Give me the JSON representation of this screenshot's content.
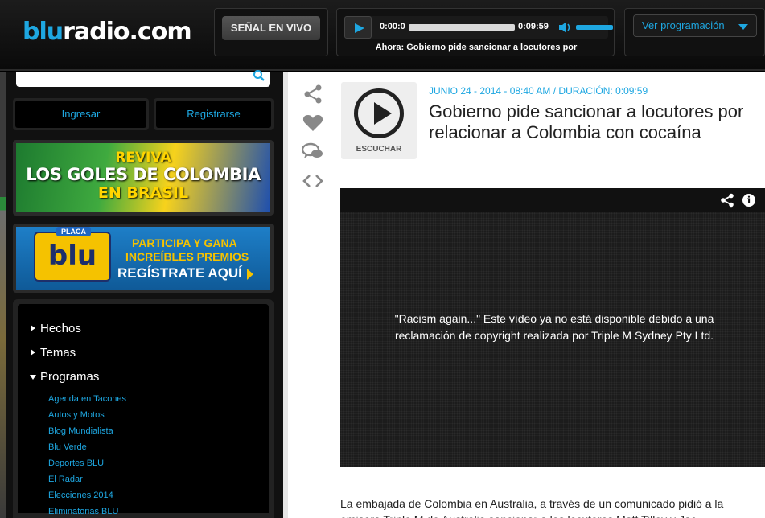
{
  "header": {
    "logo_prefix": "blu",
    "logo_suffix": "radio.com",
    "live_label": "SEÑAL EN VIVO",
    "player": {
      "current_time": "0:00:0",
      "duration": "0:09:59",
      "now_playing": "Ahora: Gobierno pide sancionar a locutores por"
    },
    "programacion_label": "Ver programación"
  },
  "sidebar": {
    "login_label": "Ingresar",
    "register_label": "Registrarse",
    "banner1": {
      "line1": "REVIVA",
      "line2": "LOS GOLES DE COLOMBIA",
      "line3": "EN BRASIL"
    },
    "banner2": {
      "placa_top": "PLACA",
      "placa_logo": "blu",
      "line1": "PARTICIPA Y GANA",
      "line2": "INCREÍBLES PREMIOS",
      "line3": "REGÍSTRATE AQUÍ"
    },
    "nav": [
      {
        "label": "Hechos"
      },
      {
        "label": "Temas"
      },
      {
        "label": "Programas"
      }
    ],
    "programas": [
      "Agenda en Tacones",
      "Autos y Motos",
      "Blog Mundialista",
      "Blu Verde",
      "Deportes BLU",
      "El Radar",
      "Elecciones 2014",
      "Eliminatorias BLU"
    ]
  },
  "article": {
    "listen_label": "ESCUCHAR",
    "meta": "JUNIO 24 - 2014 - 08:40 AM / DURACIÓN: 0:09:59",
    "title": "Gobierno pide sancionar a locutores por relacionar a Colombia con cocaína",
    "video_message": "\"Racism again...\" Este vídeo ya no está disponible debido a una reclamación de copyright realizada por Triple M Sydney Pty Ltd.",
    "body_line1": "La embajada de Colombia en Australia, a través de un comunicado  pidió a la",
    "body_line2": "emisora Triple M de Australia sancionar a los locutores Matt Tilley y Jac..."
  },
  "colors": {
    "accent": "#1ea7e1",
    "header_bg": "#111111",
    "sidebar_bg": "#111111"
  }
}
